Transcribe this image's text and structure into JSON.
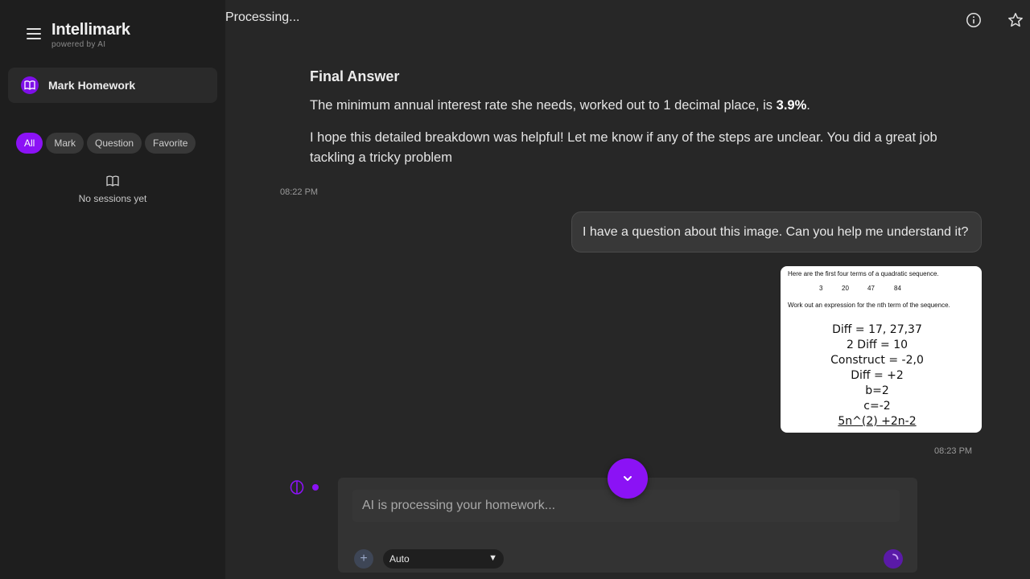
{
  "app": {
    "title": "Intellimark",
    "subtitle": "powered by AI"
  },
  "sidebar": {
    "mark_homework": "Mark Homework",
    "filters": [
      "All",
      "Mark",
      "Question",
      "Favorite"
    ],
    "active_filter": "All",
    "empty_text": "No sessions yet"
  },
  "header": {
    "status": "Processing..."
  },
  "messages": {
    "assistant": {
      "heading": "Final Answer",
      "para1_prefix": "The minimum annual interest rate she needs, worked out to 1 decimal place, is ",
      "para1_bold": "3.9%",
      "para1_suffix": ".",
      "para2": "I hope this detailed breakdown was helpful! Let me know if any of the steps are unclear. You did a great job tackling a tricky problem",
      "time": "08:22 PM"
    },
    "user": {
      "text": "I have a question about this image. Can you help me understand it?",
      "time": "08:23 PM",
      "image": {
        "line1": "Here are the first four terms of a quadratic sequence.",
        "terms": [
          "3",
          "20",
          "47",
          "84"
        ],
        "line2": "Work out an expression for the nth term of the sequence.",
        "work": [
          "Diff = 17, 27,37",
          "2 Diff = 10",
          "Construct = -2,0",
          "Diff = +2",
          "b=2",
          "c=-2",
          "5n^(2) +2n-2"
        ]
      }
    }
  },
  "composer": {
    "placeholder": "AI is processing your homework...",
    "attach_label": "+",
    "model": "Auto"
  },
  "colors": {
    "accent": "#8b12f5",
    "sidebar_bg": "#1e1e1e",
    "main_bg": "#272727"
  }
}
